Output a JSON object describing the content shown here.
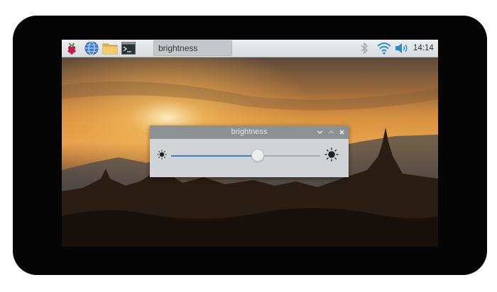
{
  "taskbar": {
    "launchers": [
      {
        "icon": "raspberry-menu-icon"
      },
      {
        "icon": "web-browser-icon"
      },
      {
        "icon": "file-manager-icon"
      },
      {
        "icon": "terminal-icon"
      }
    ],
    "task_button_label": "brightness",
    "tray": {
      "bluetooth_icon": "bluetooth-icon",
      "wifi_icon": "wifi-icon",
      "volume_icon": "volume-icon",
      "clock": "14:14"
    }
  },
  "dialog": {
    "title": "brightness",
    "controls": [
      "minimize-icon",
      "maximize-icon",
      "close-icon"
    ],
    "slider": {
      "min_icon": "brightness-low-icon",
      "max_icon": "brightness-high-icon",
      "value_fraction": 0.58
    }
  },
  "colors": {
    "slider_fill": "#3b7cd1",
    "taskbar_bg": "#e3e6e8",
    "dialog_bg": "#d0d4d7",
    "titlebar_bg": "#8c9194"
  }
}
